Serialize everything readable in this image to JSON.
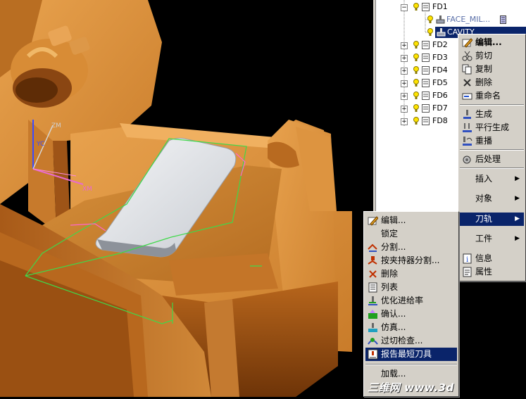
{
  "tree": {
    "nodes": [
      {
        "id": "fd1",
        "label": "FD1",
        "expanded": true
      },
      {
        "id": "face-mil",
        "label": "FACE_MIL..."
      },
      {
        "id": "cavity",
        "label": "CAVITY"
      },
      {
        "id": "fd2",
        "label": "FD2"
      },
      {
        "id": "fd3",
        "label": "FD3"
      },
      {
        "id": "fd4",
        "label": "FD4"
      },
      {
        "id": "fd5",
        "label": "FD5"
      },
      {
        "id": "fd6",
        "label": "FD6"
      },
      {
        "id": "fd7",
        "label": "FD7"
      },
      {
        "id": "fd8",
        "label": "FD8"
      }
    ],
    "expand_glyph": "+",
    "collapse_glyph": "−"
  },
  "context_menu": {
    "items": [
      {
        "label": "编辑...",
        "icon": "edit-icon",
        "bold": true
      },
      {
        "label": "剪切",
        "icon": "cut-icon"
      },
      {
        "label": "复制",
        "icon": "copy-icon"
      },
      {
        "label": "删除",
        "icon": "delete-icon"
      },
      {
        "label": "重命名",
        "icon": "rename-icon"
      },
      {
        "label": "生成",
        "icon": "generate-icon"
      },
      {
        "label": "平行生成",
        "icon": "parallel-generate-icon"
      },
      {
        "label": "重播",
        "icon": "replay-icon"
      },
      {
        "label": "后处理",
        "icon": "postprocess-icon"
      },
      {
        "label": "插入",
        "submenu": true
      },
      {
        "label": "对象",
        "submenu": true
      },
      {
        "label": "刀轨",
        "submenu": true,
        "selected": true
      },
      {
        "label": "工件",
        "submenu": true
      },
      {
        "label": "信息",
        "icon": "info-icon"
      },
      {
        "label": "属性",
        "icon": "properties-icon"
      }
    ]
  },
  "toolpath_submenu": {
    "items": [
      {
        "label": "编辑...",
        "icon": "edit-toolpath-icon"
      },
      {
        "label": "锁定"
      },
      {
        "label": "分割...",
        "icon": "split-icon"
      },
      {
        "label": "按夹持器分割...",
        "icon": "split-by-holder-icon"
      },
      {
        "label": "删除",
        "icon": "delete-toolpath-icon"
      },
      {
        "label": "列表",
        "icon": "list-icon"
      },
      {
        "label": "优化进给率",
        "icon": "optimize-feed-icon"
      },
      {
        "label": "确认...",
        "icon": "verify-icon"
      },
      {
        "label": "仿真...",
        "icon": "simulate-icon"
      },
      {
        "label": "过切检查...",
        "icon": "gouge-check-icon"
      },
      {
        "label": "报告最短刀具",
        "icon": "report-shortest-tool-icon",
        "selected": true
      },
      {
        "label": "加载..."
      }
    ]
  },
  "viewport": {
    "axis_labels": {
      "z": "ZM",
      "yc": "YC",
      "xm": "XM"
    }
  },
  "watermark": "三维网 www.3d"
}
